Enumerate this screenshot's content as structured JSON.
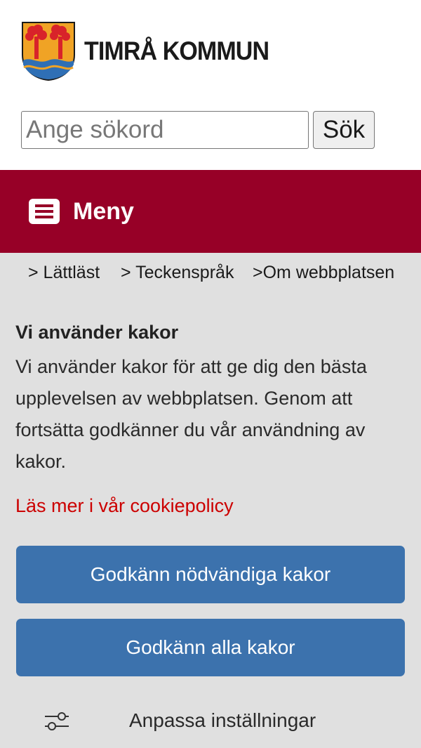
{
  "header": {
    "logo_text": "TIMRÅ KOMMUN",
    "logo_icon": "timra-coat-of-arms-icon",
    "search_placeholder": "Ange sökord",
    "search_value": "",
    "search_button_label": "Sök"
  },
  "menu": {
    "label": "Meny",
    "icon": "list-icon",
    "background_color": "#970027"
  },
  "quicklinks": [
    "> Lättläst",
    "> Teckenspråk",
    ">Om webbplatsen"
  ],
  "cookie_banner": {
    "title": "Vi använder kakor",
    "body": "Vi använder kakor för att ge dig den bästa upplevelsen av webbplatsen. Genom att fortsätta godkänner du vår användning av kakor.",
    "policy_link": "Läs mer i vår cookiepolicy",
    "accept_necessary_label": "Godkänn nödvändiga kakor",
    "accept_all_label": "Godkänn alla kakor",
    "customize_label": "Anpassa inställningar",
    "customize_icon": "sliders-icon",
    "button_color": "#3c72ad",
    "link_color": "#cc0000",
    "background_color": "#e0e0e0"
  }
}
